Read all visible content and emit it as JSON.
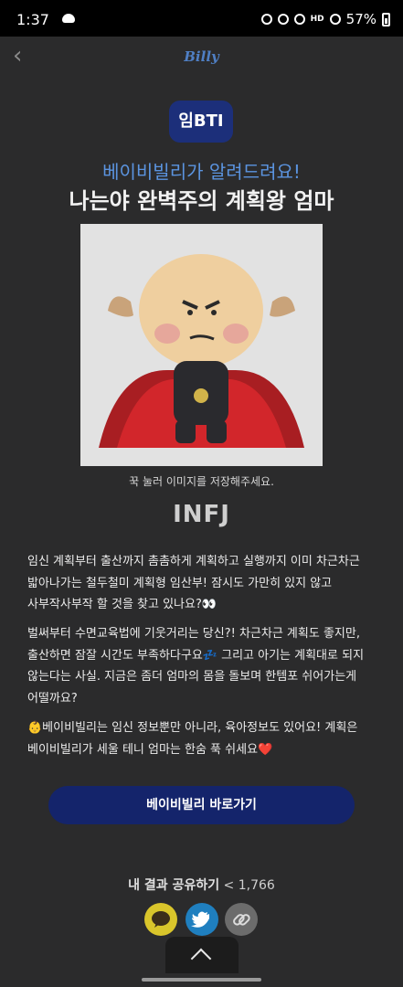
{
  "status": {
    "time": "1:37",
    "network": "HD",
    "battery": "57%"
  },
  "header": {
    "logo": "Billy"
  },
  "badge": "임BTI",
  "subtitle": "베이비빌리가 알려드려요!",
  "title": "나는야 완벽주의 계획왕 엄마",
  "image_caption": "꾹 눌러 이미지를 저장해주세요.",
  "mbti": "INFJ",
  "paragraphs": {
    "p1": "임신 계획부터 출산까지 촘촘하게 계획하고 실행까지 이미 차근차근 밟아나가는 철두철미 계획형 임산부! 잠시도 가만히 있지 않고 사부작사부작 할 것을 찾고 있나요?👀",
    "p2": "벌써부터 수면교육법에 기웃거리는 당신?! 차근차근 계획도 좋지만, 출산하면 잠잘 시간도 부족하다구요💤 그리고 아기는 계획대로 되지 않는다는 사실. 지금은 좀더 엄마의 몸을 돌보며 한템포 쉬어가는게 어떨까요?",
    "p3": "👶베이비빌리는 임신 정보뿐만 아니라, 육아정보도 있어요! 계획은 베이비빌리가 세울 테니 엄마는 한숨 푹 쉬세요❤️"
  },
  "cta_label": "베이비빌리 바로가기",
  "share": {
    "label": "내 결과 공유하기",
    "count": "1,766"
  }
}
